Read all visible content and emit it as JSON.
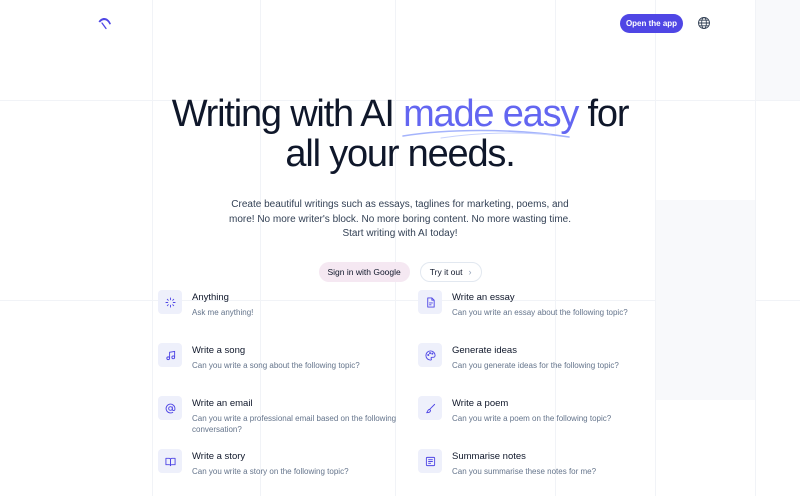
{
  "header": {
    "open_app_label": "Open the app",
    "logo_icon": "quill-logo-icon",
    "language_icon": "globe-icon"
  },
  "hero": {
    "title_part1": "Writing with AI ",
    "title_accent": "made easy",
    "title_part2": " for",
    "title_line2": "all your needs.",
    "subtitle": "Create beautiful writings such as essays, taglines for marketing, poems, and more! No more writer's block. No more boring content. No more wasting time. Start writing with AI today!",
    "sign_in_label": "Sign in with Google",
    "try_label": "Try it out",
    "accent_color": "#6366f1"
  },
  "features": [
    {
      "title": "Anything",
      "desc": "Ask me anything!",
      "icon": "sparkle-icon"
    },
    {
      "title": "Write an essay",
      "desc": "Can you write an essay about the following topic?",
      "icon": "document-icon"
    },
    {
      "title": "Write a song",
      "desc": "Can you write a song about the following topic?",
      "icon": "music-note-icon"
    },
    {
      "title": "Generate ideas",
      "desc": "Can you generate ideas for the following topic?",
      "icon": "palette-icon"
    },
    {
      "title": "Write an email",
      "desc": "Can you write a professional email based on the following conversation?",
      "icon": "at-sign-icon"
    },
    {
      "title": "Write a poem",
      "desc": "Can you write a poem on the following topic?",
      "icon": "brush-icon"
    },
    {
      "title": "Write a story",
      "desc": "Can you write a story on the following topic?",
      "icon": "book-icon"
    },
    {
      "title": "Summarise notes",
      "desc": "Can you summarise these notes for me?",
      "icon": "notes-icon"
    }
  ],
  "colors": {
    "brand": "#4f46e5",
    "icon_bg": "#eef0fb",
    "google_button_bg": "#f5e8f2"
  }
}
